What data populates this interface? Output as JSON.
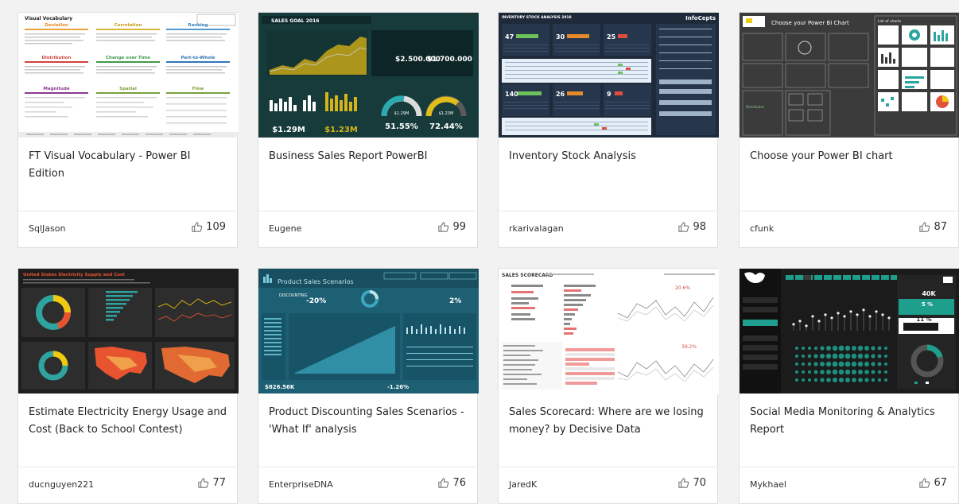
{
  "cards": [
    {
      "title": "FT Visual Vocabulary - Power BI Edition",
      "author": "SqlJason",
      "likes": "109",
      "thumb": {
        "heading": "Visual Vocabulary",
        "c1": "Deviation",
        "c2": "Correlation",
        "c3": "Ranking",
        "c4": "Distribution",
        "c5": "Change over Time",
        "c6": "Part-to-Whole",
        "c7": "Magnitude",
        "c8": "Spatial",
        "c9": "Flow"
      }
    },
    {
      "title": "Business Sales Report PowerBI",
      "author": "Eugene",
      "likes": "99",
      "thumb": {
        "heading": "SALES GOAL 2016",
        "v1": "$2.500.000",
        "v2": "$1.700.000",
        "v3": "$1.29M",
        "v4": "$1.23M",
        "v5": "51.55%",
        "v6": "72.44%",
        "g1": "$1.29M",
        "g2": "$1.23M"
      }
    },
    {
      "title": "Inventory Stock Analysis",
      "author": "rkarivalagan",
      "likes": "98",
      "thumb": {
        "heading": "INVENTORY STOCK ANALYSIS 2018",
        "brand": "InfoCepts",
        "n1": "47",
        "n2": "30",
        "n3": "25",
        "n4": "140",
        "n5": "26",
        "n6": "9"
      }
    },
    {
      "title": "Choose your Power BI chart",
      "author": "cfunk",
      "likes": "87",
      "thumb": {
        "heading": "Choose your Power BI Chart",
        "list": "List of charts"
      }
    },
    {
      "title": "Estimate Electricity Energy Usage and Cost (Back to School Contest)",
      "author": "ducnguyen221",
      "likes": "77",
      "thumb": {
        "heading": "United States Electricity Supply and Cost"
      }
    },
    {
      "title": "Product Discounting Sales Scenarios - 'What If' analysis",
      "author": "EnterpriseDNA",
      "likes": "76",
      "thumb": {
        "heading": "Product Sales Scenarios",
        "d1": "-20%",
        "d2": "2%",
        "k1": "$826.56K",
        "k2": "-1.26%",
        "k3": "DISCOUNTING"
      }
    },
    {
      "title": "Sales Scorecard: Where are we losing money? by Decisive Data",
      "author": "JaredK",
      "likes": "70",
      "thumb": {
        "heading": "SALES SCORECARD",
        "p1": "20.6%",
        "p2": "39.2%"
      }
    },
    {
      "title": "Social Media Monitoring & Analytics Report",
      "author": "Mykhael",
      "likes": "67",
      "thumb": {
        "k1": "40K",
        "k2": "5 %",
        "k3": "11 %"
      }
    }
  ],
  "colors": {
    "page_bg": "#f2f2f2",
    "card_bg": "#ffffff",
    "card_border": "#e1dfdd",
    "text": "#252423"
  }
}
